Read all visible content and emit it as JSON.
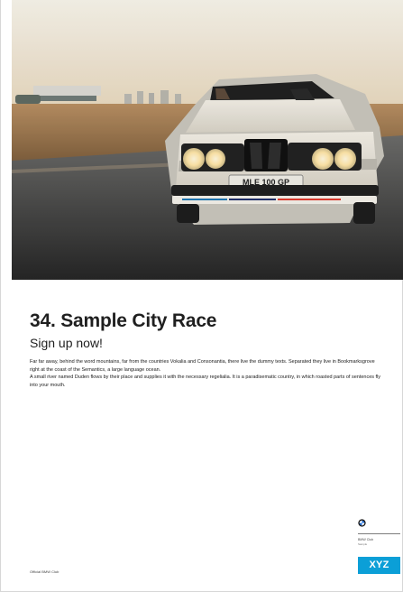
{
  "hero": {
    "image_name": "vintage-car-photo",
    "license_plate": "MLE 100 GP"
  },
  "main": {
    "title": "34. Sample City Race",
    "subtitle": "Sign up now!",
    "paragraphs": [
      "Far far away, behind the word mountains, far from the countries Vokalia and Consonantia, there live the dummy texts. Separated they live in Bookmarksgrove right at the coast of the Semantics, a large language ocean.",
      "A small river named Duden flows by their place and supplies it with the necessary regelialia. It is a paradisematic country, in which roasted parts of sentences fly into your mouth."
    ]
  },
  "logo": {
    "roundel_icon": "bmw-roundel-icon",
    "club_name": "BMW Club",
    "club_subtext": "Sample",
    "badge_label": "XYZ",
    "badge_color": "#0b9fd7"
  },
  "footer": {
    "note": "Official BMW Club"
  }
}
